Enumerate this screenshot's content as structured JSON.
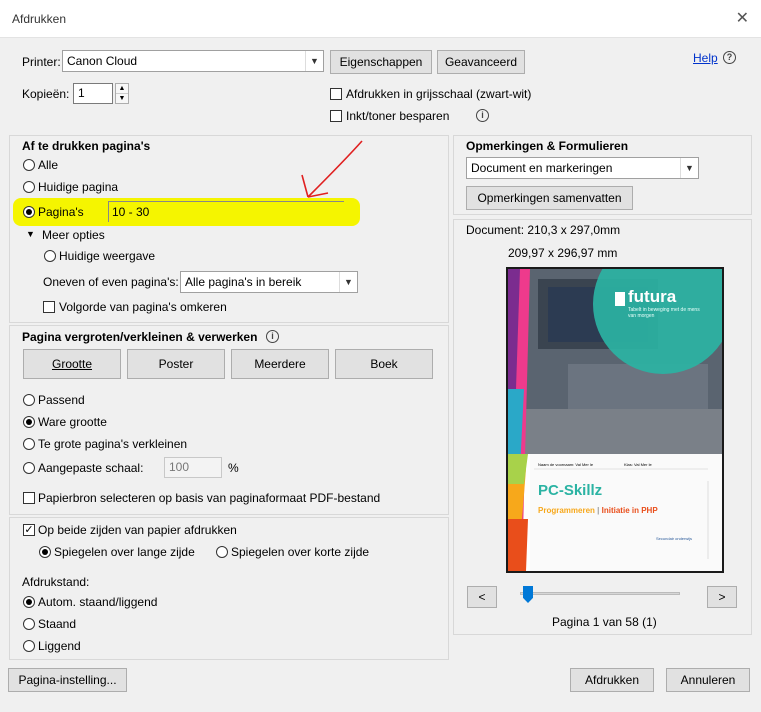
{
  "window": {
    "title": "Afdrukken",
    "close_glyph": "✕"
  },
  "printer": {
    "label": "Printer:",
    "value": "Canon Cloud",
    "properties_button": "Eigenschappen",
    "advanced_button": "Geavanceerd",
    "help_link": "Help",
    "help_icon": "?"
  },
  "copies": {
    "label": "Kopieën:",
    "value": "1"
  },
  "options": {
    "grayscale": "Afdrukken in grijsschaal (zwart-wit)",
    "save_ink": "Inkt/toner besparen"
  },
  "pages_section": {
    "title": "Af te drukken pagina's",
    "all": "Alle",
    "current": "Huidige pagina",
    "pages": "Pagina's",
    "pages_value": "10 - 30",
    "more_options": "Meer opties",
    "current_view": "Huidige weergave",
    "odd_even_label": "Oneven of even pagina's:",
    "odd_even_value": "Alle pagina's in bereik",
    "reverse": "Volgorde van pagina's omkeren"
  },
  "sizing_section": {
    "title": "Pagina vergroten/verkleinen & verwerken",
    "buttons": [
      "Grootte",
      "Poster",
      "Meerdere",
      "Boek"
    ],
    "fit": "Passend",
    "actual_size": "Ware grootte",
    "shrink": "Te grote pagina's verkleinen",
    "custom_scale": "Aangepaste schaal:",
    "custom_scale_value": "100",
    "percent": "%",
    "paper_source": "Papierbron selecteren op basis van paginaformaat PDF-bestand"
  },
  "duplex_section": {
    "both_sides": "Op beide zijden van papier afdrukken",
    "long_edge": "Spiegelen over lange zijde",
    "short_edge": "Spiegelen over korte zijde",
    "orientation_label": "Afdrukstand:",
    "auto": "Autom. staand/liggend",
    "portrait": "Staand",
    "landscape": "Liggend"
  },
  "comments_section": {
    "title": "Opmerkingen & Formulieren",
    "value": "Document en markeringen",
    "summarize_button": "Opmerkingen samenvatten"
  },
  "preview": {
    "document_size": "Document: 210,3 x 297,0mm",
    "page_size": "209,97 x 296,97 mm",
    "prev": "<",
    "next": ">",
    "page_indicator": "Pagina 1 van 58 (1)",
    "slider_fraction": 0.0,
    "thumb": {
      "logo": "futura",
      "tagline": "Tabelt in beweging met de mens van morgen",
      "meta_left": "Naam de voornaam: Val Mer le",
      "meta_right": "Klas: Val Mer le",
      "book_title": "PC-Skillz",
      "subtitle_a": "Programmeren",
      "subtitle_sep": "|",
      "subtitle_b": "Initiatie in PHP",
      "footer": "Secundair onderwijs"
    }
  },
  "footer": {
    "page_setup_button": "Pagina-instelling...",
    "print_button": "Afdrukken",
    "cancel_button": "Annuleren"
  },
  "annotation": {
    "highlight_color": "#f5f500",
    "arrow_color": "#e02020"
  }
}
